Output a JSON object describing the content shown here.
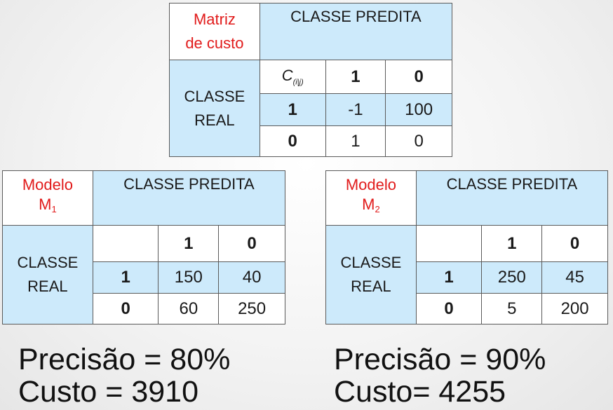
{
  "cost_matrix": {
    "title_line1": "Matriz",
    "title_line2": "de custo",
    "predicted_header": "CLASSE PREDITA",
    "real_line1": "CLASSE",
    "real_line2": "REAL",
    "cij_main": "C",
    "cij_sub": "(i|j)",
    "col_labels": [
      "1",
      "0"
    ],
    "rows": [
      {
        "label": "1",
        "values": [
          "-1",
          "100"
        ]
      },
      {
        "label": "0",
        "values": [
          "1",
          "0"
        ]
      }
    ]
  },
  "model1": {
    "title_line1": "Modelo",
    "title_main": "M",
    "title_sub": "1",
    "predicted_header": "CLASSE PREDITA",
    "real_line1": "CLASSE",
    "real_line2": "REAL",
    "col_labels": [
      "1",
      "0"
    ],
    "rows": [
      {
        "label": "1",
        "values": [
          "150",
          "40"
        ]
      },
      {
        "label": "0",
        "values": [
          "60",
          "250"
        ]
      }
    ],
    "precision_text": "Precisão = 80%",
    "cost_text": "Custo = 3910"
  },
  "model2": {
    "title_line1": "Modelo",
    "title_main": "M",
    "title_sub": "2",
    "predicted_header": "CLASSE PREDITA",
    "real_line1": "CLASSE",
    "real_line2": "REAL",
    "col_labels": [
      "1",
      "0"
    ],
    "rows": [
      {
        "label": "1",
        "values": [
          "250",
          "45"
        ]
      },
      {
        "label": "0",
        "values": [
          "5",
          "200"
        ]
      }
    ],
    "precision_text": "Precisão = 90%",
    "cost_text": "Custo= 4255"
  },
  "colors": {
    "header_blue": "#cdeafb",
    "title_red": "#e11b1b",
    "border": "#5a5a5a"
  }
}
